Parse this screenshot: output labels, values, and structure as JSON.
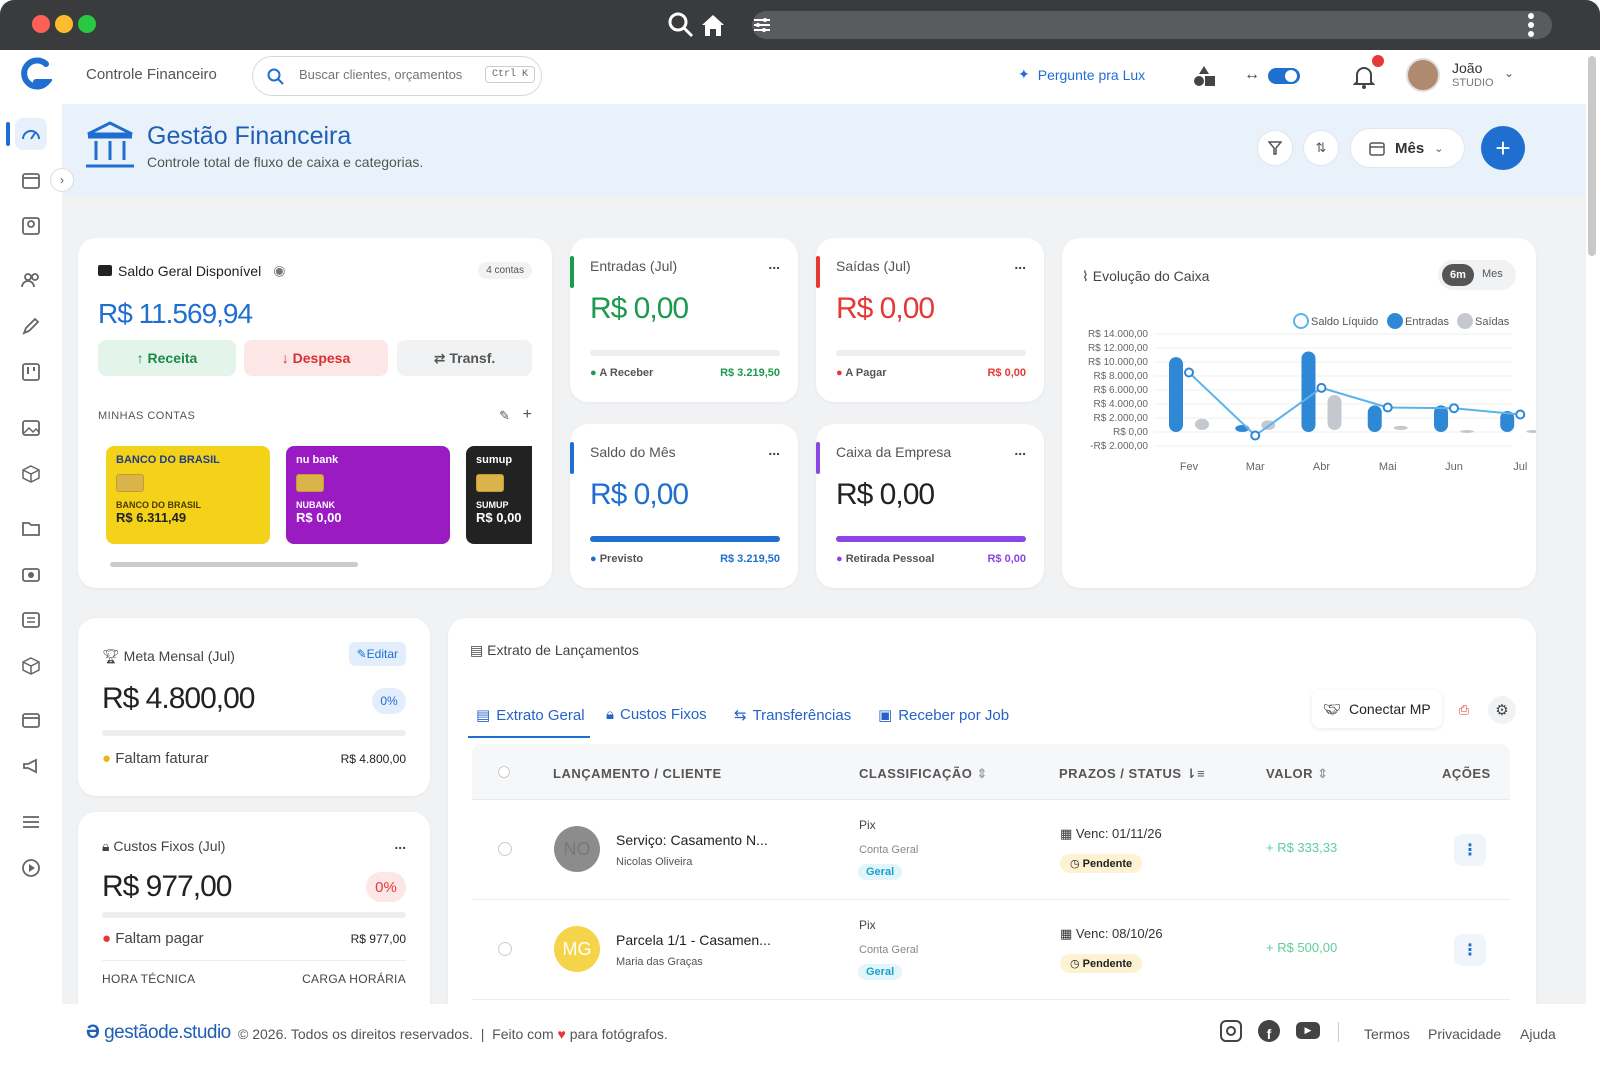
{
  "nav": {
    "title": "Controle Financeiro",
    "search_placeholder": "Buscar clientes, orçamentos",
    "shortcut": "Ctrl K",
    "ask_lux": "Pergunte pra Lux",
    "user_name": "João",
    "user_role": "STUDIO"
  },
  "header": {
    "title": "Gestão Financeira",
    "subtitle": "Controle total de fluxo de caixa e categorias.",
    "period": "Mês"
  },
  "saldo": {
    "title": "Saldo Geral Disponível",
    "accounts_badge": "4 contas",
    "value": "R$ 11.569,94",
    "btn_receita": "Receita",
    "btn_despesa": "Despesa",
    "btn_transf": "Transf.",
    "my_accounts": "MINHAS CONTAS",
    "banks": [
      {
        "logo": "BANCO DO BRASIL",
        "name": "BANCO DO BRASIL",
        "value": "R$ 6.311,49",
        "color": "#f6d71a"
      },
      {
        "logo": "nu bank",
        "name": "NUBANK",
        "value": "R$ 0,00",
        "color": "#9a1bc2"
      },
      {
        "logo": "sumup",
        "name": "SUMUP",
        "value": "R$ 0,00",
        "color": "#222"
      }
    ]
  },
  "entradas": {
    "title": "Entradas (Jul)",
    "value": "R$ 0,00",
    "foot_label": "A Receber",
    "foot_value": "R$ 3.219,50",
    "more": "..."
  },
  "saidas": {
    "title": "Saídas (Jul)",
    "value": "R$ 0,00",
    "foot_label": "A Pagar",
    "foot_value": "R$ 0,00",
    "more": "..."
  },
  "saldo_mes": {
    "title": "Saldo do Mês",
    "value": "R$ 0,00",
    "foot_label": "Previsto",
    "foot_value": "R$ 3.219,50",
    "more": "..."
  },
  "caixa": {
    "title": "Caixa da Empresa",
    "value": "R$ 0,00",
    "foot_label": "Retirada Pessoal",
    "foot_value": "R$ 0,00",
    "more": "..."
  },
  "evolucao": {
    "title": "Evolução do Caixa",
    "toggle_a": "6m",
    "toggle_b": "Mes"
  },
  "chart_data": {
    "type": "bar",
    "title": "Evolução do Caixa",
    "categories": [
      "Fev",
      "Mar",
      "Abr",
      "Mai",
      "Jun",
      "Jul"
    ],
    "yticks": [
      "R$ 14.000,00",
      "R$ 12.000,00",
      "R$ 10.000,00",
      "R$ 8.000,00",
      "R$ 6.000,00",
      "R$ 4.000,00",
      "R$ 2.000,00",
      "R$ 0,00",
      "-R$ 2.000,00"
    ],
    "ylim": [
      -2000,
      14000
    ],
    "series": [
      {
        "name": "Saldo Líquido",
        "type": "line",
        "color": "#5bb3ea",
        "values": [
          8500,
          -500,
          6300,
          3500,
          3400,
          2500
        ]
      },
      {
        "name": "Entradas",
        "type": "bar",
        "color": "#2e88d6",
        "values": [
          10700,
          1000,
          11500,
          3800,
          3800,
          3000
        ]
      },
      {
        "name": "Saídas",
        "type": "bar",
        "color": "#c5c9cf",
        "values": [
          1600,
          1400,
          5000,
          600,
          0,
          0
        ]
      }
    ],
    "legend": "top-right"
  },
  "meta": {
    "title": "Meta Mensal (Jul)",
    "edit": "Editar",
    "value": "R$ 4.800,00",
    "pct": "0%",
    "foot_label": "Faltam faturar",
    "foot_value": "R$ 4.800,00"
  },
  "custos": {
    "title": "Custos Fixos (Jul)",
    "value": "R$ 977,00",
    "pct": "0%",
    "foot_label": "Faltam pagar",
    "foot_value": "R$ 977,00",
    "hora": "HORA TÉCNICA",
    "carga": "CARGA HORÁRIA",
    "more": "..."
  },
  "extrato": {
    "title": "Extrato de Lançamentos",
    "tabs": [
      "Extrato Geral",
      "Custos Fixos",
      "Transferências",
      "Receber por Job"
    ],
    "connect": "Conectar MP",
    "cols": [
      "LANÇAMENTO / CLIENTE",
      "CLASSIFICAÇÃO",
      "PRAZOS / STATUS",
      "VALOR",
      "AÇÕES"
    ],
    "rows": [
      {
        "initials": "NO",
        "title": "Serviço: Casamento N...",
        "client": "Nicolas Oliveira",
        "method": "Pix",
        "account": "Conta Geral",
        "tag": "Geral",
        "due": "Venc: 01/11/26",
        "status": "Pendente",
        "value": "+ R$ 333,33",
        "color": "#8c8c8c"
      },
      {
        "initials": "MG",
        "title": "Parcela 1/1 - Casamen...",
        "client": "Maria das Graças",
        "method": "Pix",
        "account": "Conta Geral",
        "tag": "Geral",
        "due": "Venc: 08/10/26",
        "status": "Pendente",
        "value": "+ R$ 500,00",
        "color": "#f6d44a"
      }
    ]
  },
  "footer": {
    "brand": "gestãode.studio",
    "copyright": "© 2026. Todos os direitos reservados.",
    "sep": "|",
    "made_a": "Feito com",
    "made_b": "para fotógrafos.",
    "links": [
      "Termos",
      "Privacidade",
      "Ajuda"
    ]
  }
}
